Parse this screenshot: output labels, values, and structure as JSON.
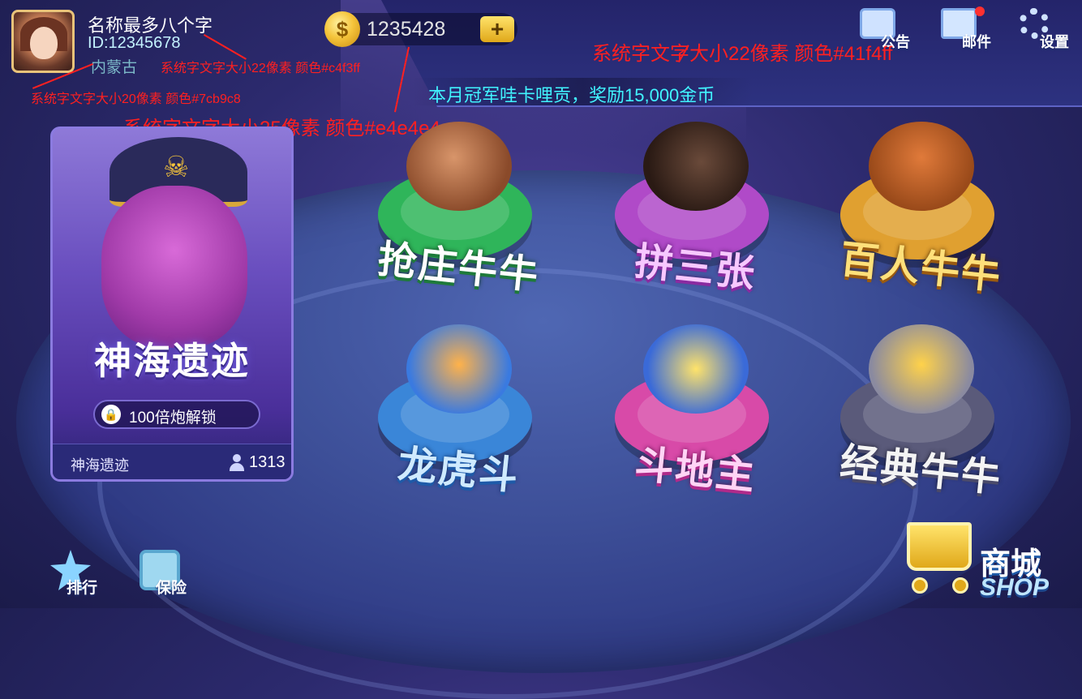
{
  "header": {
    "user_name": "名称最多八个字",
    "user_id": "ID:12345678",
    "location": "内蒙古",
    "coins": "1235428",
    "coin_symbol": "$",
    "add_coins_symbol": "+",
    "marquee": "本月冠军哇卡哩贡，奖励15,000金币",
    "buttons": [
      {
        "label": "公告",
        "icon": "notice-icon"
      },
      {
        "label": "邮件",
        "icon": "mail-icon"
      },
      {
        "label": "设置",
        "icon": "gear-icon"
      }
    ]
  },
  "annotations": [
    "系统字文字大小22像素  颜色#c4f3ff",
    "系统字文字大小20像素  颜色#7cb9c8",
    "系统字文字大小25像素  颜色#e4e4e4",
    "系统字文字大小22像素  颜色#41f4ff"
  ],
  "feature": {
    "title": "神海遗迹",
    "unlock": "100倍炮解锁",
    "footer_name": "神海遗迹",
    "players": "1313"
  },
  "games": [
    {
      "label": "抢庄牛牛",
      "theme": "green",
      "color": "#2fb55a"
    },
    {
      "label": "拼三张",
      "theme": "purple",
      "color": "#b04ac8"
    },
    {
      "label": "百人牛牛",
      "theme": "gold",
      "color": "#e0a030"
    },
    {
      "label": "龙虎斗",
      "theme": "blue",
      "color": "#3a86d8"
    },
    {
      "label": "斗地主",
      "theme": "pink",
      "color": "#d84aa8"
    },
    {
      "label": "经典牛牛",
      "theme": "silver",
      "color": "#5a5a7a"
    }
  ],
  "bottom": {
    "rank_label": "排行",
    "safe_label": "保险",
    "shop_label_cn": "商城",
    "shop_label_en": "SHOP"
  },
  "colors": {
    "user_id": "#c4f3ff",
    "location": "#7cb9c8",
    "coins": "#e4e4e4",
    "marquee": "#41f4ff"
  }
}
